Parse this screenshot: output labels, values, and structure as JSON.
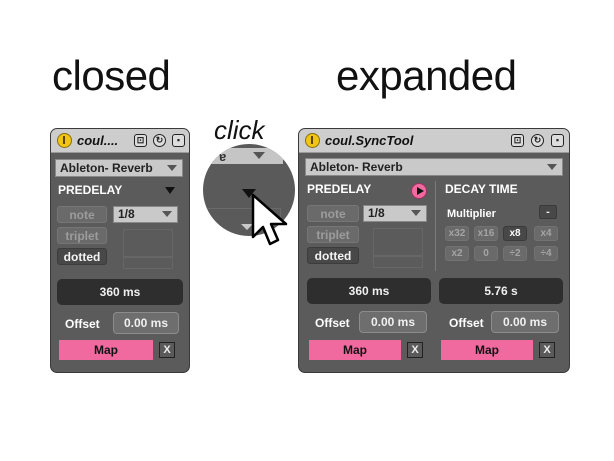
{
  "captions": {
    "closed": "closed",
    "expanded": "expanded",
    "click": "click"
  },
  "colors": {
    "accent_pink": "#f06aa0",
    "power_yellow": "#f0c419",
    "panel": "#5b5b5b",
    "display_bg": "#2e2e2e"
  },
  "closed_device": {
    "title": "coul....",
    "preset": "Ableton- Reverb",
    "section": "PREDELAY",
    "note_btn": "note",
    "division": "1/8",
    "triplet_btn": "triplet",
    "dotted_btn": "dotted",
    "readout": "360 ms",
    "offset_label": "Offset",
    "offset_value": "0.00 ms",
    "map_btn": "Map",
    "unmap_btn": "X"
  },
  "expanded_device": {
    "title": "coul.SyncTool",
    "preset": "Ableton- Reverb",
    "predelay": {
      "section": "PREDELAY",
      "note_btn": "note",
      "division": "1/8",
      "triplet_btn": "triplet",
      "dotted_btn": "dotted",
      "readout": "360 ms",
      "offset_label": "Offset",
      "offset_value": "0.00 ms",
      "map_btn": "Map",
      "unmap_btn": "X"
    },
    "decay": {
      "section": "DECAY TIME",
      "multiplier_label": "Multiplier",
      "minus_btn": "-",
      "row1": [
        "x32",
        "x16",
        "x8",
        "x4"
      ],
      "row2": [
        "x2",
        "0",
        "÷2",
        "÷4"
      ],
      "selected": "x8",
      "readout": "5.76 s",
      "offset_label": "Offset",
      "offset_value": "0.00 ms",
      "map_btn": "Map",
      "unmap_btn": "X"
    }
  },
  "icons": [
    "power-icon",
    "pin-icon",
    "hot-swap-icon",
    "save-icon",
    "dropdown-arrow-icon",
    "expand-triangle-icon",
    "play-icon",
    "mouse-cursor-icon"
  ]
}
